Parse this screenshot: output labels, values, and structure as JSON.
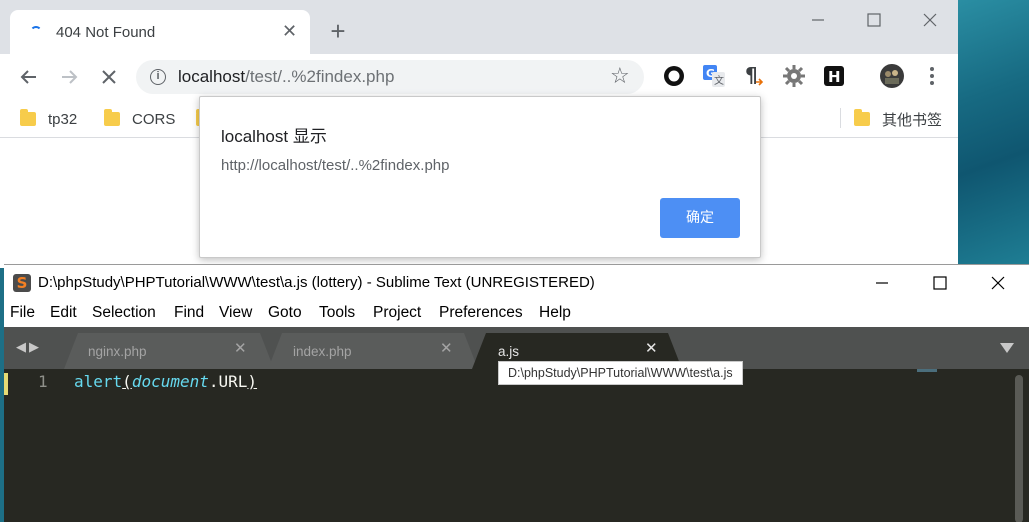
{
  "chrome": {
    "tab": {
      "title": "404 Not Found",
      "close": "✕"
    },
    "new_tab": "+",
    "toolbar": {
      "url_host": "localhost",
      "url_path": "/test/..%2findex.php"
    },
    "bookmarks": [
      {
        "label": "tp32"
      },
      {
        "label": "CORS"
      },
      {
        "label": ""
      }
    ],
    "bookmarks_other": "其他书签",
    "dialog": {
      "title": "localhost 显示",
      "message": "http://localhost/test/..%2findex.php",
      "ok_label": "确定"
    },
    "icons": [
      "globe-loading-icon",
      "back-icon",
      "forward-icon",
      "stop-icon",
      "info-icon",
      "star-icon",
      "circle-extension-icon",
      "translate-icon",
      "pilcrow-icon",
      "gear-icon",
      "h-extension-icon",
      "avatar",
      "menu-dots-icon"
    ]
  },
  "sublime": {
    "logo": "S",
    "title": "D:\\phpStudy\\PHPTutorial\\WWW\\test\\a.js (lottery) - Sublime Text (UNREGISTERED)",
    "menu": [
      "File",
      "Edit",
      "Selection",
      "Find",
      "View",
      "Goto",
      "Tools",
      "Project",
      "Preferences",
      "Help"
    ],
    "tabs": [
      {
        "name": "nginx.php",
        "close": "✕"
      },
      {
        "name": "index.php",
        "close": "✕"
      },
      {
        "name": "a.js",
        "close": "✕"
      }
    ],
    "tooltip": "D:\\phpStudy\\PHPTutorial\\WWW\\test\\a.js",
    "editor": {
      "line_number": "1",
      "code": {
        "fn": "alert",
        "open": "(",
        "obj": "document",
        "prop": ".URL",
        "close": ")"
      }
    },
    "colors": {
      "editor_bg": "#272822",
      "tab_bar": "#4f5150",
      "keyword": "#66d9ef"
    }
  }
}
